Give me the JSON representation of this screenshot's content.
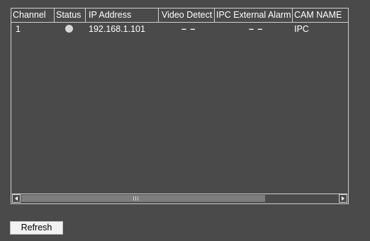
{
  "table": {
    "columns": [
      "Channel",
      "Status",
      "IP Address",
      "Video Detect",
      "IPC External Alarm",
      "CAM NAME"
    ],
    "rows": [
      {
        "channel": "1",
        "status": "online",
        "ip_address": "192.168.1.101",
        "video_detect": "– –",
        "ipc_external_alarm": "– –",
        "cam_name": "IPC"
      }
    ]
  },
  "scrollbar": {
    "position_fraction": 0,
    "visible_fraction": 0.77
  },
  "colors": {
    "background": "#4a4a4a",
    "border": "#cfcfcf",
    "status_dot": "#d8d8d8",
    "button_bg": "#f2f2f2"
  },
  "refresh_button": {
    "label": "Refresh"
  }
}
